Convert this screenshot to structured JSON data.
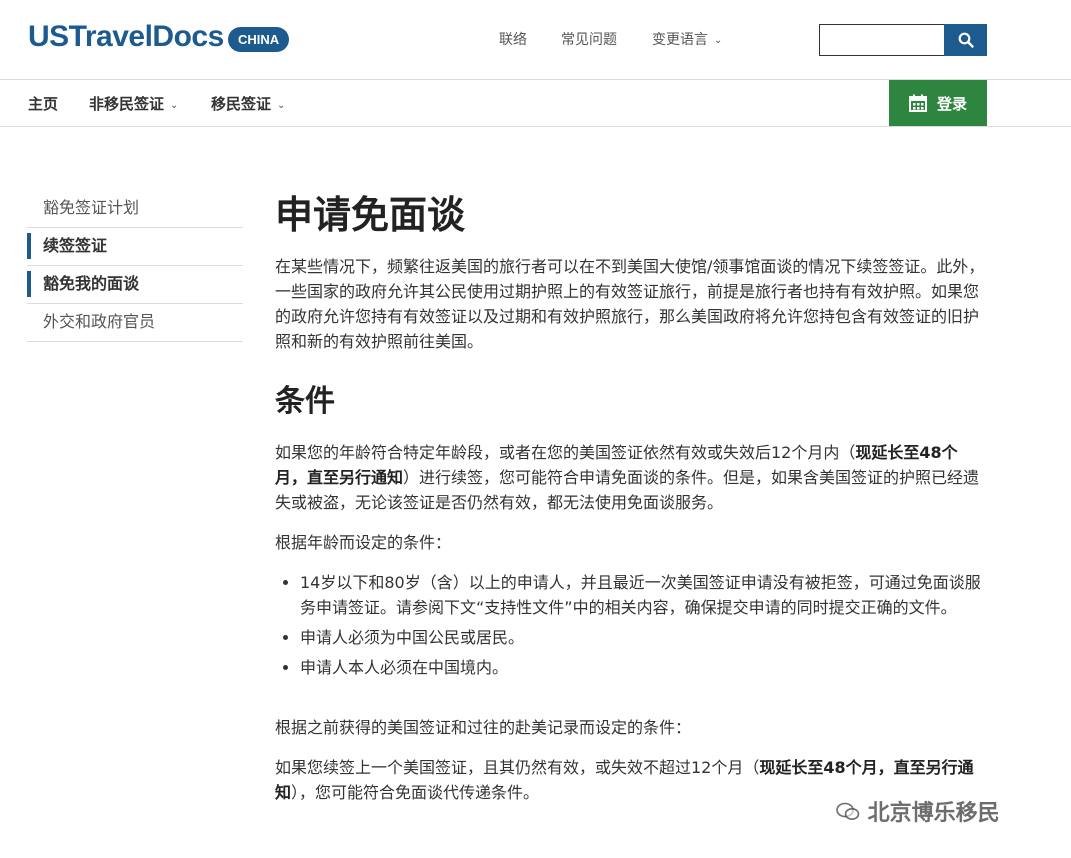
{
  "header": {
    "logo_text": "USTravelDocs",
    "country_badge": "CHINA",
    "links": [
      "联络",
      "常见问题",
      "变更语言"
    ],
    "search_placeholder": ""
  },
  "nav": {
    "items": [
      "主页",
      "非移民签证",
      "移民签证"
    ],
    "login_label": "登录"
  },
  "sidebar": {
    "items": [
      {
        "label": "豁免签证计划",
        "active": false
      },
      {
        "label": "续签签证",
        "active": true
      },
      {
        "label": "豁免我的面谈",
        "active": true
      },
      {
        "label": "外交和政府官员",
        "active": false
      }
    ]
  },
  "main": {
    "title": "申请免面谈",
    "intro": "在某些情况下，频繁往返美国的旅行者可以在不到美国大使馆/领事馆面谈的情况下续签签证。此外，一些国家的政府允许其公民使用过期护照上的有效签证旅行，前提是旅行者也持有有效护照。如果您的政府允许您持有有效签证以及过期和有效护照旅行，那么美国政府将允许您持包含有效签证的旧护照和新的有效护照前往美国。",
    "conditions_heading": "条件",
    "cond_p1_before": "如果您的年龄符合特定年龄段，或者在您的美国签证依然有效或失效后12个月内（",
    "cond_p1_bold": "现延长至48个月，直至另行通知",
    "cond_p1_after": "）进行续签，您可能符合申请免面谈的条件。但是，如果含美国签证的护照已经遗失或被盗，无论该签证是否仍然有效，都无法使用免面谈服务。",
    "age_label": "根据年龄而设定的条件：",
    "age_bullets": [
      "14岁以下和80岁（含）以上的申请人，并且最近一次美国签证申请没有被拒签，可通过免面谈服务申请签证。请参阅下文“支持性文件”中的相关内容，确保提交申请的同时提交正确的文件。",
      "申请人必须为中国公民或居民。",
      "申请人本人必须在中国境内。"
    ],
    "prior_label": "根据之前获得的美国签证和过往的赴美记录而设定的条件：",
    "cond_p2_before": "如果您续签上一个美国签证，且其仍然有效，或失效不超过12个月（",
    "cond_p2_bold": "现延长至48个月，直至另行通知",
    "cond_p2_after": "），您可能符合免面谈代传递条件。"
  },
  "watermark_text": "北京博乐移民",
  "colors": {
    "brand_blue": "#1d5a8e",
    "login_green": "#2e8540"
  }
}
